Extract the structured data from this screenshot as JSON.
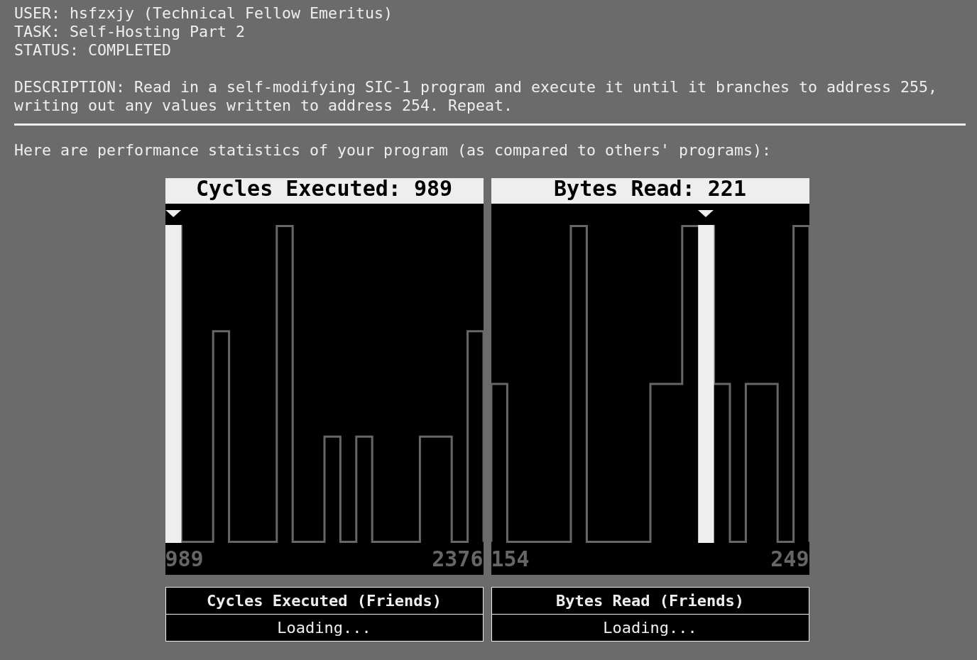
{
  "header": {
    "user": "USER: hsfzxjy (Technical Fellow Emeritus)",
    "task": "TASK: Self-Hosting Part 2",
    "status": "STATUS: COMPLETED",
    "description": "DESCRIPTION: Read in a self-modifying SIC-1 program and execute it until it branches to address 255, writing out any values written to address 254. Repeat."
  },
  "intro": "Here are performance statistics of your program (as compared to others' programs):",
  "charts": [
    {
      "title": "Cycles Executed: 989",
      "min_label": "989",
      "max_label": "2376",
      "marker": {
        "level": 0.025
      }
    },
    {
      "title": "Bytes Read: 221",
      "min_label": "154",
      "max_label": "249",
      "marker": {
        "level": 0.674
      }
    }
  ],
  "friends": [
    {
      "title": "Cycles Executed (Friends)",
      "status": "Loading..."
    },
    {
      "title": "Bytes Read (Friends)",
      "status": "Loading..."
    }
  ]
}
